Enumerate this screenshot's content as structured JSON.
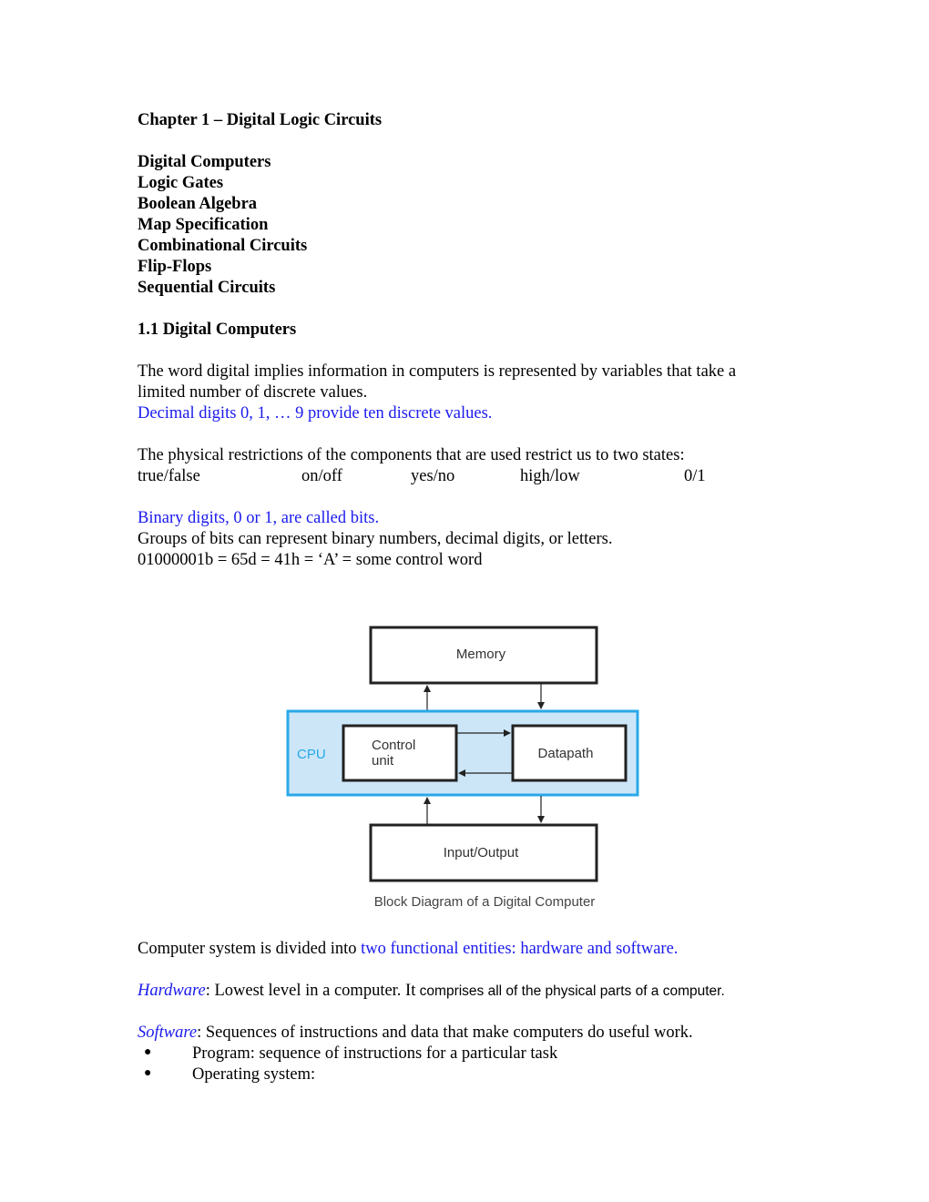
{
  "title": "Chapter 1 – Digital Logic Circuits",
  "toc": [
    "Digital Computers",
    "Logic Gates",
    "Boolean Algebra",
    "Map Specification",
    "Combinational Circuits",
    "Flip-Flops",
    "Sequential Circuits"
  ],
  "section_heading": "1.1 Digital Computers",
  "para1": {
    "line1": "The word digital implies information in computers is represented by variables that take a",
    "line2": "limited number of discrete values.",
    "line3_highlight": "Decimal digits 0, 1, … 9 provide ten discrete values."
  },
  "para2": {
    "line1": "The physical restrictions of the components that are used restrict us to two states:",
    "states": [
      "true/false",
      "on/off",
      "yes/no",
      "high/low",
      "0/1"
    ]
  },
  "para3": {
    "line1_highlight": "Binary digits, 0 or 1, are called bits.",
    "line2": "Groups of bits can represent binary numbers, decimal digits, or letters.",
    "line3": "01000001b = 65d = 41h = ‘A’ = some control word"
  },
  "diagram": {
    "memory": "Memory",
    "cpu": "CPU",
    "control_line1": "Control",
    "control_line2": "unit",
    "datapath": "Datapath",
    "io": "Input/Output",
    "caption": "Block Diagram of a Digital Computer",
    "colors": {
      "cpu_fill": "#cce6f8",
      "cpu_border": "#29a8e8",
      "cpu_label": "#29a8e8",
      "box_border": "#222222"
    }
  },
  "para4": {
    "prefix": "Computer system is divided into ",
    "highlight": "two functional entities: hardware and software."
  },
  "hardware": {
    "term": "Hardware",
    "text_serif": ": Lowest level in a computer. It",
    "text_sans": " comprises all of the physical parts of a computer."
  },
  "software": {
    "term": "Software",
    "text": ": Sequences of instructions and data that make computers do useful work.",
    "bullets": [
      "Program: sequence of instructions for a particular task",
      "Operating system:"
    ]
  },
  "colors": {
    "highlight_blue": "#1a1aee"
  }
}
